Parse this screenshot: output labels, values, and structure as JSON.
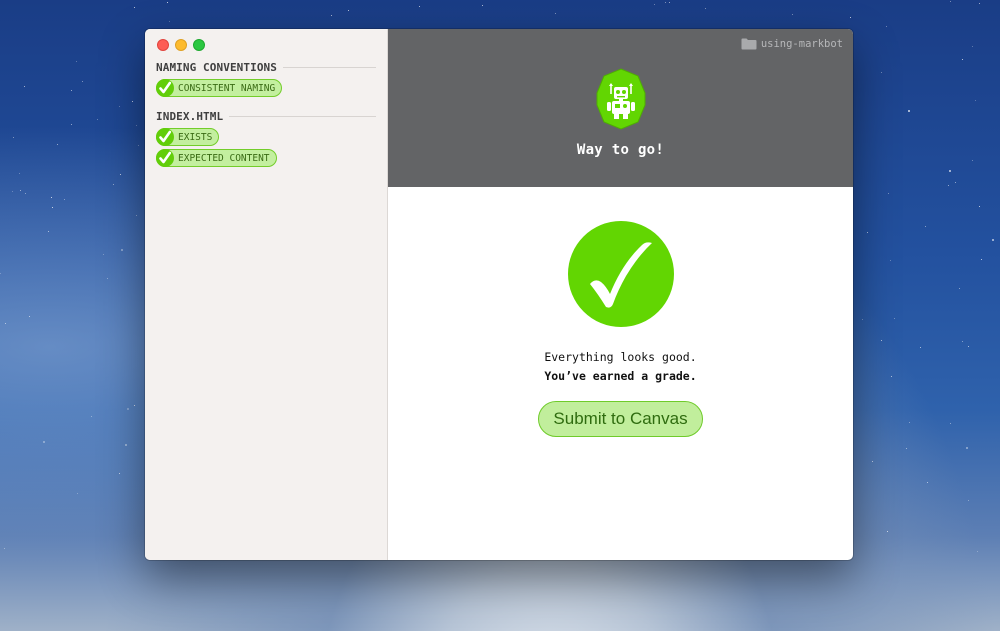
{
  "sidebar": {
    "groups": [
      {
        "title": "NAMING CONVENTIONS",
        "items": [
          {
            "label": "CONSISTENT NAMING",
            "status": "pass"
          }
        ]
      },
      {
        "title": "INDEX.HTML",
        "items": [
          {
            "label": "EXISTS",
            "status": "pass"
          },
          {
            "label": "EXPECTED CONTENT",
            "status": "pass"
          }
        ]
      }
    ]
  },
  "header": {
    "folder_label": "using-markbot",
    "folder_icon": "folder-icon",
    "robot_icon": "robot-badge-icon",
    "message": "Way to go!"
  },
  "main": {
    "status_icon": "checkmark-icon",
    "line1": "Everything looks good.",
    "line2": "You’ve earned a grade.",
    "submit_label": "Submit to Canvas"
  },
  "colors": {
    "accent_green": "#62d602",
    "badge_fill": "#c3ef9f",
    "header_bg": "#636466",
    "sidebar_bg": "#f4f1ef"
  }
}
